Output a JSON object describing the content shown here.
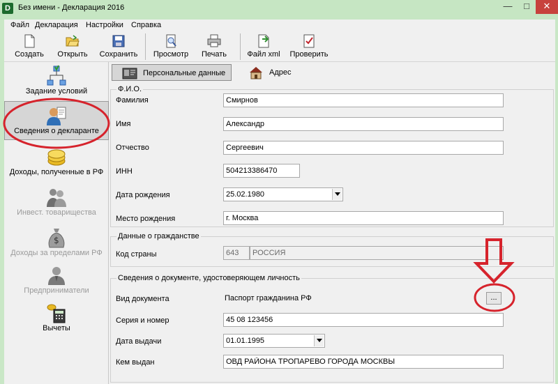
{
  "window": {
    "title": "Без имени - Декларация 2016",
    "app_icon": "D"
  },
  "menu": [
    "Файл",
    "Декларация",
    "Настройки",
    "Справка"
  ],
  "toolbar": {
    "create": "Создать",
    "open": "Открыть",
    "save": "Сохранить",
    "preview": "Просмотр",
    "print": "Печать",
    "xml": "Файл xml",
    "check": "Проверить"
  },
  "sidebar": {
    "items": [
      {
        "label": "Задание условий"
      },
      {
        "label": "Сведения о декларанте"
      },
      {
        "label": "Доходы, полученные в РФ"
      },
      {
        "label": "Инвест. товарищества"
      },
      {
        "label": "Доходы за пределами РФ"
      },
      {
        "label": "Предприниматели"
      },
      {
        "label": "Вычеты"
      }
    ]
  },
  "tabs": {
    "personal": "Персональные данные",
    "address": "Адрес"
  },
  "fio": {
    "legend": "Ф.И.О.",
    "surname_label": "Фамилия",
    "surname": "Смирнов",
    "name_label": "Имя",
    "name": "Александр",
    "patronymic_label": "Отчество",
    "patronymic": "Сергеевич",
    "inn_label": "ИНН",
    "inn": "504213386470",
    "birth_date_label": "Дата рождения",
    "birth_date": "25.02.1980",
    "birth_place_label": "Место рождения",
    "birth_place": "г. Москва"
  },
  "citizenship": {
    "legend": "Данные о гражданстве",
    "country_code_label": "Код страны",
    "country_code": "643",
    "country_name": "РОССИЯ"
  },
  "document": {
    "legend": "Сведения о документе, удостоверяющем личность",
    "type_label": "Вид документа",
    "type": "Паспорт гражданина РФ",
    "dots": "...",
    "series_label": "Серия и номер",
    "series": "45 08 123456",
    "issue_date_label": "Дата выдачи",
    "issue_date": "01.01.1995",
    "issued_by_label": "Кем выдан",
    "issued_by": "ОВД РАЙОНА ТРОПАРЕВО ГОРОДА МОСКВЫ"
  },
  "colors": {
    "window_frame": "#c6e6c3",
    "annotation_red": "#d6232c",
    "close_button": "#c7423d"
  }
}
